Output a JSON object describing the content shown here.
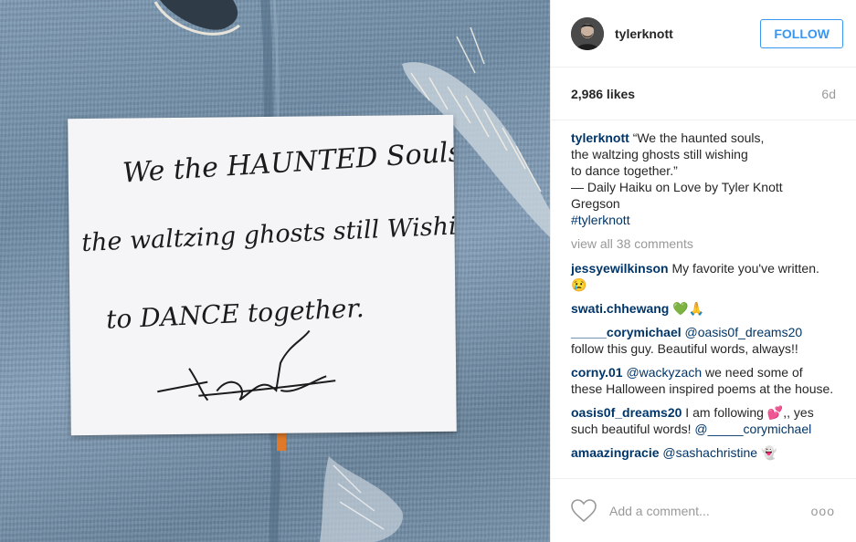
{
  "header": {
    "username": "tylerknott",
    "follow_label": "FOLLOW"
  },
  "meta": {
    "likes": "2,986 likes",
    "time": "6d"
  },
  "caption": {
    "user": "tylerknott",
    "lines": [
      "“We the haunted souls,",
      "the waltzing ghosts still wishing",
      "to dance together.”",
      "— Daily Haiku on Love by Tyler Knott",
      "Gregson"
    ],
    "hashtag": "#tylerknott"
  },
  "view_all": "view all 38 comments",
  "comments": [
    {
      "user": "jessyewilkinson",
      "text": " My favorite you've written. ",
      "emoji": "😢"
    },
    {
      "user": "swati.chhewang",
      "text": " ",
      "emoji": "💚🙏"
    },
    {
      "user": "_____corymichael",
      "mention": "@oasis0f_dreams20",
      "text": " follow this guy. Beautiful words, always!!"
    },
    {
      "user": "corny.01",
      "mention": "@wackyzach",
      "text": " we need some of these Halloween inspired poems at the house."
    },
    {
      "user": "oasis0f_dreams20",
      "text": " I am following ",
      "emoji": "💕",
      "text2": ",, yes such beautiful words! ",
      "mention2": "@_____corymichael"
    },
    {
      "user": "amaazingracie",
      "mention": "@sashachristine",
      "emoji": "👻"
    }
  ],
  "footer": {
    "placeholder": "Add a comment...",
    "more": "ooo"
  },
  "note_text": {
    "line1": "We the HAUNTED Souls,",
    "line2": "the waltzing ghosts still Wishing",
    "line3": "to DANCE together.",
    "signature": "TK G"
  },
  "colors": {
    "accent": "#3897f0",
    "username": "#003569",
    "muted": "#999999"
  }
}
